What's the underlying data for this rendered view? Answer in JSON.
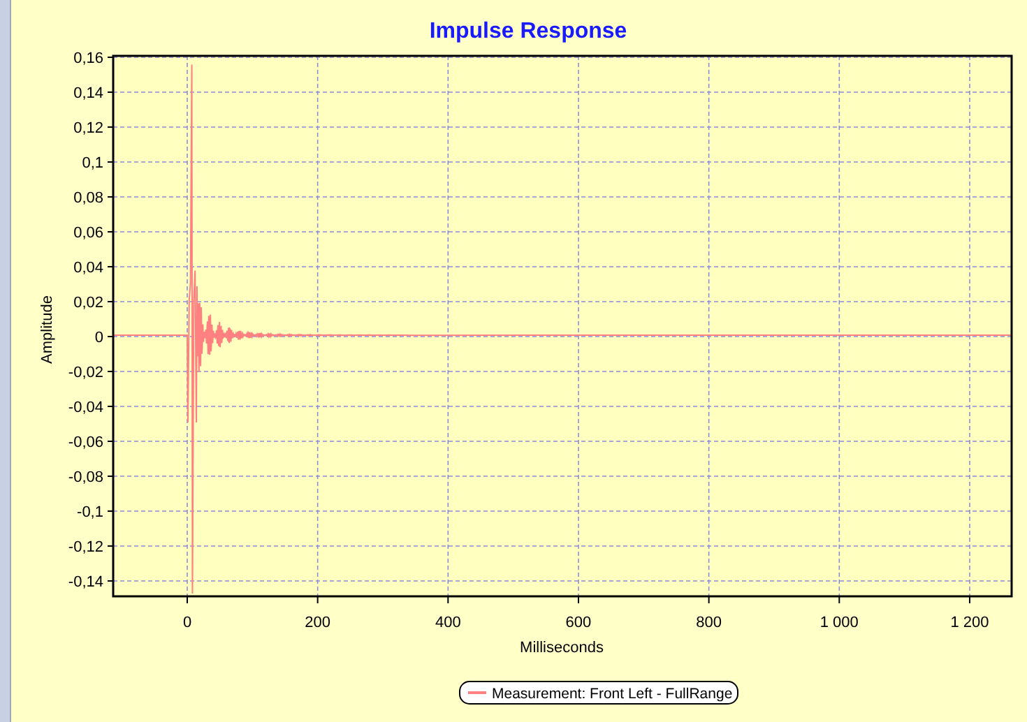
{
  "chart": {
    "title": "Impulse Response",
    "ylabel": "Amplitude",
    "xlabel": "Milliseconds",
    "yticks": [
      "0,16",
      "0,14",
      "0,12",
      "0,1",
      "0,08",
      "0,06",
      "0,04",
      "0,02",
      "0",
      "-0,02",
      "-0,04",
      "-0,06",
      "-0,08",
      "-0,1",
      "-0,12",
      "-0,14"
    ],
    "xticks": [
      "0",
      "200",
      "400",
      "600",
      "800",
      "1 000",
      "1 200"
    ],
    "legend": {
      "label": "Measurement: Front Left - FullRange",
      "color": "#ff8080"
    }
  }
}
